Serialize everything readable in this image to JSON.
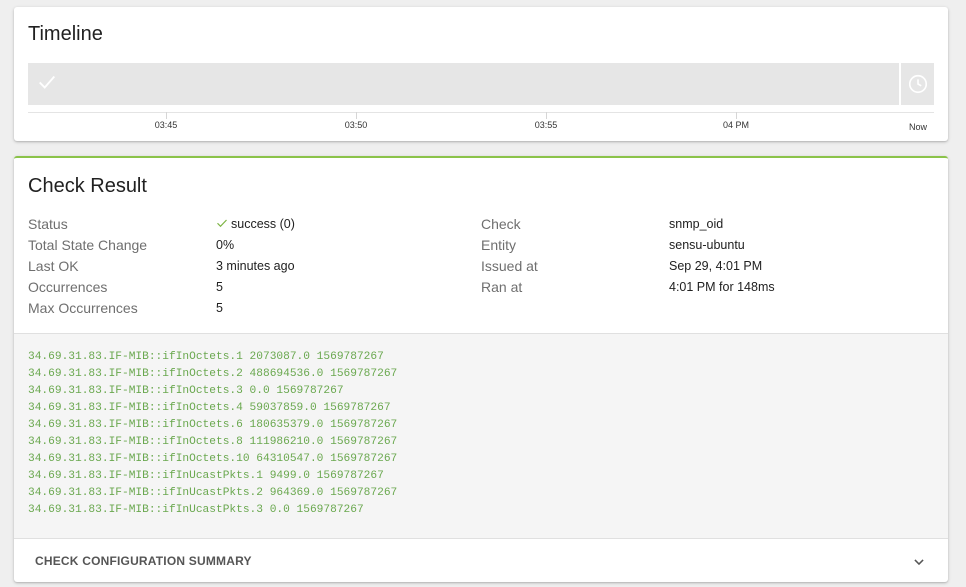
{
  "timeline": {
    "title": "Timeline",
    "ticks": [
      "03:45",
      "03:50",
      "03:55",
      "04 PM",
      "Now"
    ]
  },
  "check_result": {
    "title": "Check Result",
    "left_fields": [
      {
        "label": "Status",
        "value": "success (0)"
      },
      {
        "label": "Total State Change",
        "value": "0%"
      },
      {
        "label": "Last OK",
        "value": "3 minutes ago"
      },
      {
        "label": "Occurrences",
        "value": "5"
      },
      {
        "label": "Max Occurrences",
        "value": "5"
      }
    ],
    "right_fields": [
      {
        "label": "Check",
        "value": "snmp_oid"
      },
      {
        "label": "Entity",
        "value": "sensu-ubuntu"
      },
      {
        "label": "Issued at",
        "value": "Sep 29, 4:01 PM"
      },
      {
        "label": "Ran at",
        "value": "4:01 PM for 148ms"
      }
    ],
    "output_lines": [
      "34.69.31.83.IF-MIB::ifInOctets.1 2073087.0 1569787267",
      "34.69.31.83.IF-MIB::ifInOctets.2 488694536.0 1569787267",
      "34.69.31.83.IF-MIB::ifInOctets.3 0.0 1569787267",
      "34.69.31.83.IF-MIB::ifInOctets.4 59037859.0 1569787267",
      "34.69.31.83.IF-MIB::ifInOctets.6 180635379.0 1569787267",
      "34.69.31.83.IF-MIB::ifInOctets.8 111986210.0 1569787267",
      "34.69.31.83.IF-MIB::ifInOctets.10 64310547.0 1569787267",
      "34.69.31.83.IF-MIB::ifInUcastPkts.1 9499.0 1569787267",
      "34.69.31.83.IF-MIB::ifInUcastPkts.2 964369.0 1569787267",
      "34.69.31.83.IF-MIB::ifInUcastPkts.3 0.0 1569787267"
    ],
    "summary_label": "CHECK CONFIGURATION SUMMARY"
  },
  "colors": {
    "accent": "#8bc34a",
    "output_text": "#6aa84f",
    "success_check": "#7cb342"
  },
  "icons": {
    "timeline_event": "check-icon",
    "timeline_now": "clock-icon",
    "status": "check-icon",
    "summary_toggle": "chevron-down-icon"
  }
}
